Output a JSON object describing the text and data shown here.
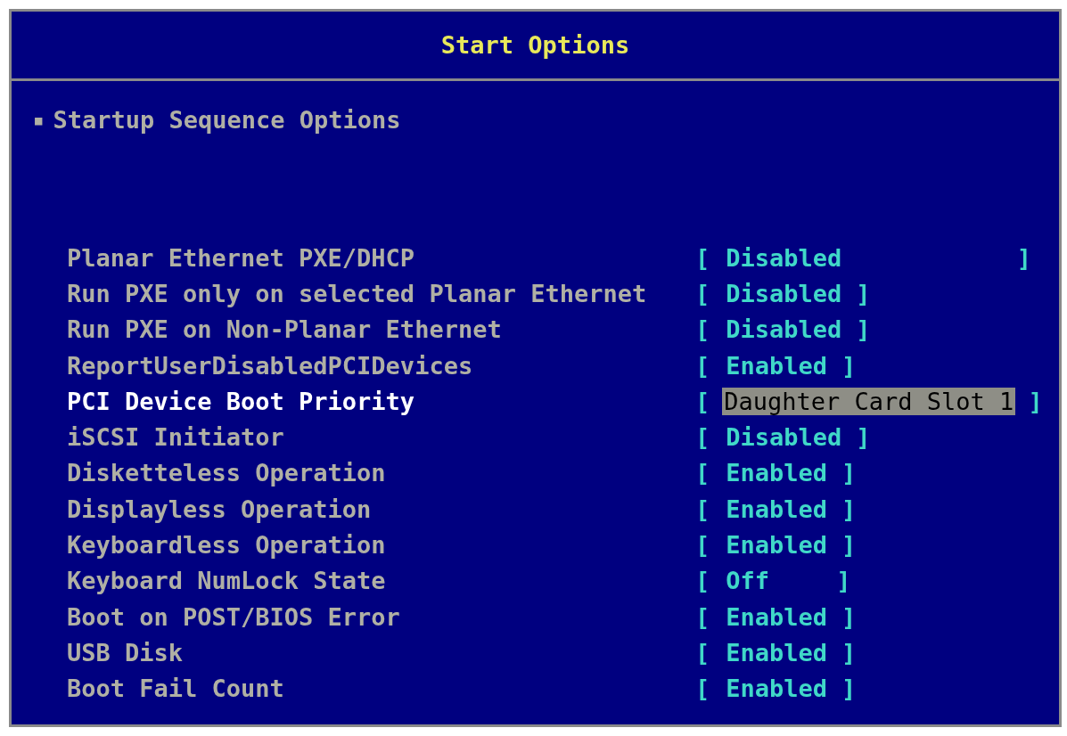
{
  "window": {
    "title": "Start Options"
  },
  "section": {
    "marker": "■",
    "label": "Startup Sequence Options"
  },
  "settings": [
    {
      "label": "Planar Ethernet PXE/DHCP",
      "open": "[",
      "value": "Disabled",
      "close": "]",
      "selected": false,
      "wide": true
    },
    {
      "label": "Run PXE only on selected Planar Ethernet",
      "open": "[",
      "value": "Disabled",
      "close": "]",
      "selected": false,
      "wide": false
    },
    {
      "label": "Run PXE on Non-Planar Ethernet",
      "open": "[",
      "value": "Disabled",
      "close": "]",
      "selected": false,
      "wide": false
    },
    {
      "label": "ReportUserDisabledPCIDevices",
      "open": "[",
      "value": "Enabled",
      "close": "]",
      "selected": false,
      "wide": false
    },
    {
      "label": "PCI Device Boot Priority",
      "open": "[",
      "value": "Daughter Card Slot 1",
      "close": "]",
      "selected": true,
      "wide": false
    },
    {
      "label": "iSCSI Initiator",
      "open": "[",
      "value": "Disabled",
      "close": "]",
      "selected": false,
      "wide": false
    },
    {
      "label": "Disketteless Operation",
      "open": "[",
      "value": "Enabled",
      "close": "]",
      "selected": false,
      "wide": false
    },
    {
      "label": "Displayless Operation",
      "open": "[",
      "value": "Enabled",
      "close": "]",
      "selected": false,
      "wide": false
    },
    {
      "label": "Keyboardless Operation",
      "open": "[",
      "value": "Enabled",
      "close": "]",
      "selected": false,
      "wide": false
    },
    {
      "label": "Keyboard NumLock State",
      "open": "[",
      "value": "Off",
      "close": "]",
      "selected": false,
      "wide": false
    },
    {
      "label": "Boot on POST/BIOS Error",
      "open": "[",
      "value": "Enabled",
      "close": "]",
      "selected": false,
      "wide": false
    },
    {
      "label": "USB Disk",
      "open": "[",
      "value": "Enabled",
      "close": "]",
      "selected": false,
      "wide": false
    },
    {
      "label": "Boot Fail Count",
      "open": "[",
      "value": "Enabled",
      "close": "]",
      "selected": false,
      "wide": false
    }
  ]
}
